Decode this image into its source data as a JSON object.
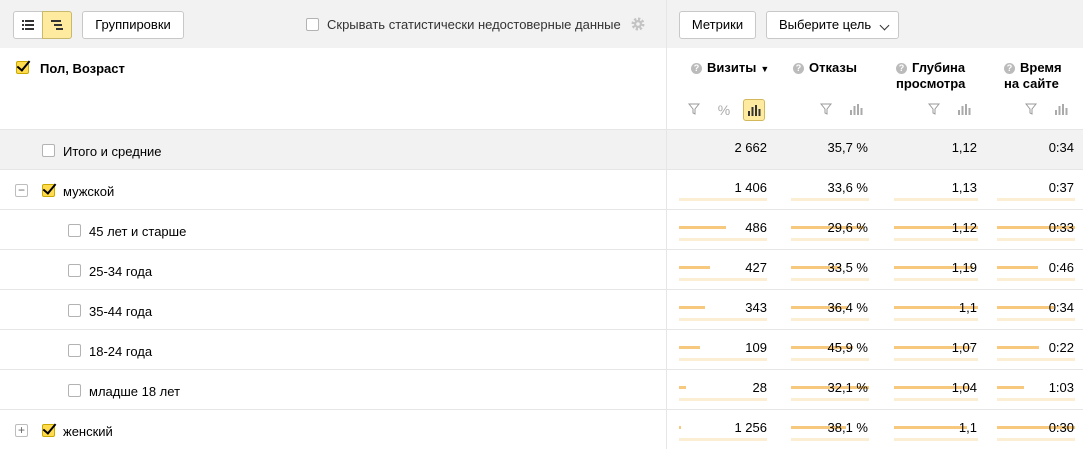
{
  "toolbar": {
    "group_label": "Группировки",
    "hide_unreliable_label": "Скрывать статистически недостоверные данные",
    "metrics_label": "Метрики",
    "goal_label": "Выберите цель"
  },
  "table": {
    "dimension_title": "Пол, Возраст",
    "columns": [
      {
        "title_line1": "Визиты",
        "title_line2": "",
        "sorted": true,
        "sort_indicator": "▼"
      },
      {
        "title_line1": "Отказы",
        "title_line2": ""
      },
      {
        "title_line1": "Глубина",
        "title_line2": "просмотра"
      },
      {
        "title_line1": "Время",
        "title_line2": "на сайте"
      }
    ],
    "help_glyph": "?",
    "percent_glyph": "%",
    "total": {
      "label": "Итого и средние",
      "values": [
        "2 662",
        "35,7 %",
        "1,12",
        "0:34"
      ]
    },
    "rows": [
      {
        "label": "мужской",
        "expander": "−",
        "level": 0,
        "checked": true,
        "values": [
          "1 406",
          "33,6 %",
          "1,13",
          "0:37"
        ],
        "fill": [
          0.53,
          0.94,
          1.0,
          1.0
        ]
      },
      {
        "label": "45 лет и старше",
        "level": 1,
        "checked": false,
        "values": [
          "486",
          "29,6 %",
          "1,12",
          "0:33"
        ],
        "fill": [
          0.35,
          0.64,
          0.94,
          0.52
        ]
      },
      {
        "label": "25-34 года",
        "level": 1,
        "checked": false,
        "values": [
          "427",
          "33,5 %",
          "1,19",
          "0:46"
        ],
        "fill": [
          0.3,
          0.73,
          1.0,
          0.73
        ]
      },
      {
        "label": "35-44 года",
        "level": 1,
        "checked": false,
        "values": [
          "343",
          "36,4 %",
          "1,1",
          "0:34"
        ],
        "fill": [
          0.24,
          0.79,
          0.92,
          0.54
        ]
      },
      {
        "label": "18-24 года",
        "level": 1,
        "checked": false,
        "values": [
          "109",
          "45,9 %",
          "1,07",
          "0:22"
        ],
        "fill": [
          0.08,
          1.0,
          0.9,
          0.35
        ]
      },
      {
        "label": "младше 18 лет",
        "level": 1,
        "checked": false,
        "values": [
          "28",
          "32,1 %",
          "1,04",
          "1:03"
        ],
        "fill": [
          0.02,
          0.7,
          0.87,
          1.0
        ]
      },
      {
        "label": "женский",
        "expander": "+",
        "level": 0,
        "checked": true,
        "values": [
          "1 256",
          "38,1 %",
          "1,1",
          "0:30"
        ],
        "fill": [
          0.9,
          1.0,
          0.92,
          0.48
        ]
      }
    ]
  },
  "colors": {
    "accent": "#ffdb4d",
    "bar": "#f7c97e",
    "bar_bg": "#fbeed2",
    "header_bg": "#f2f2f2"
  }
}
